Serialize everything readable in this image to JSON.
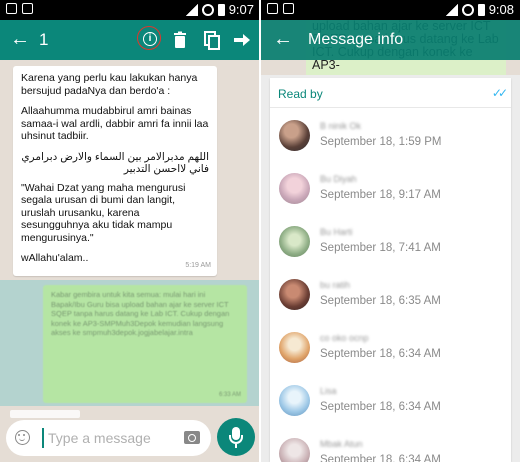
{
  "left_screen": {
    "status_bar": {
      "time": "9:07"
    },
    "action_bar": {
      "back_icon": "arrow-left-icon",
      "selected_count": "1",
      "icons": [
        "info-icon",
        "trash-icon",
        "copy-icon",
        "forward-icon"
      ]
    },
    "incoming_message": {
      "paragraphs": [
        "Karena yang perlu kau lakukan hanya bersujud padaNya dan berdo'a :",
        "Allaahumma mudabbirul amri bainas samaa-i wal ardli, dabbir amri fa innii laa uhsinut tadbiir.",
        "\"Wahai Dzat yang maha mengurusi segala urusan di bumi dan langit, uruslah urusanku, karena sesungguhnya aku tidak mampu mengurusinya.\"",
        "wAllahu'alam.."
      ],
      "arabic": "اللهم مدبرالامر بين السماء والارض دبرامري فاني لااحسن التدبير",
      "time": "5:19 AM"
    },
    "outgoing_message": {
      "text": "Kabar gembira untuk kita semua: mulai hari ini Bapak/Ibu Guru bisa upload bahan ajar ke server ICT SQEP tanpa harus datang ke Lab ICT. Cukup dengan konek ke AP3-SMPMuh3Depok kemudian langsung akses ke smpmuh3depok.jogjabelajar.intra",
      "time": "6:33 AM"
    },
    "input": {
      "placeholder": "Type a message",
      "emoji_icon": "emoji-icon",
      "camera_icon": "camera-icon",
      "mic_icon": "microphone-icon"
    }
  },
  "right_screen": {
    "status_bar": {
      "time": "9:08"
    },
    "background_message": "upload bahan ajar ke server ICT SQEP tanpa harus datang ke Lab ICT. Cukup dengan konek ke AP3-",
    "header": {
      "back_icon": "arrow-left-icon",
      "title": "Message info"
    },
    "read_by": {
      "label": "Read by",
      "tick_icon": "double-check-icon",
      "tick_color": "#34b7f1",
      "readers": [
        {
          "name": "B ninik Ok",
          "time": "September 18, 1:59 PM"
        },
        {
          "name": "Bu Diyah",
          "time": "September 18, 9:17 AM"
        },
        {
          "name": "Bu Harti",
          "time": "September 18, 7:41 AM"
        },
        {
          "name": "bu ratih",
          "time": "September 18, 6:35 AM"
        },
        {
          "name": "co oko ocnp",
          "time": "September 18, 6:34 AM"
        },
        {
          "name": "Lisa",
          "time": "September 18, 6:34 AM"
        },
        {
          "name": "Mbak Atun",
          "time": "September 18, 6:34 AM"
        }
      ]
    }
  },
  "colors": {
    "accent": "#0b877a",
    "outgoing_bubble": "#b5e5a3",
    "chat_background": "#e5ddd5"
  }
}
